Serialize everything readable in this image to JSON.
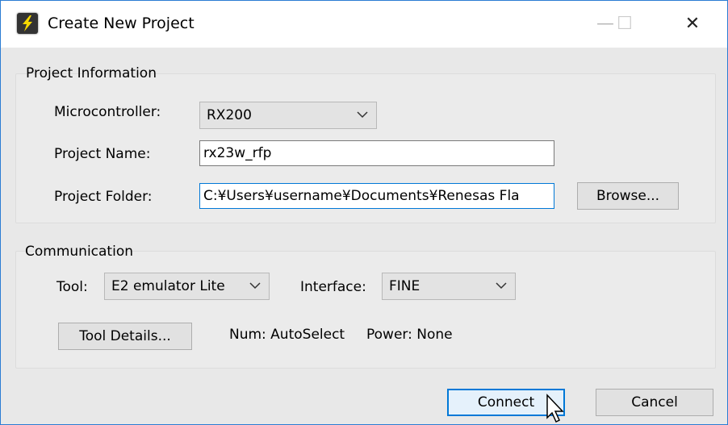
{
  "window": {
    "title": "Create New Project",
    "minimize": "—",
    "maximize": "☐",
    "close": "✕"
  },
  "project_info": {
    "title": "Project Information",
    "microcontroller_label": "Microcontroller:",
    "microcontroller_value": "RX200",
    "name_label": "Project Name:",
    "name_value": "rx23w_rfp",
    "folder_label": "Project Folder:",
    "folder_value": "C:¥Users¥username¥Documents¥Renesas Fla",
    "browse": "Browse..."
  },
  "communication": {
    "title": "Communication",
    "tool_label": "Tool:",
    "tool_value": "E2 emulator Lite",
    "interface_label": "Interface:",
    "interface_value": "FINE",
    "tool_details": "Tool Details...",
    "num": "Num: AutoSelect",
    "power": "Power: None"
  },
  "buttons": {
    "connect": "Connect",
    "cancel": "Cancel"
  }
}
